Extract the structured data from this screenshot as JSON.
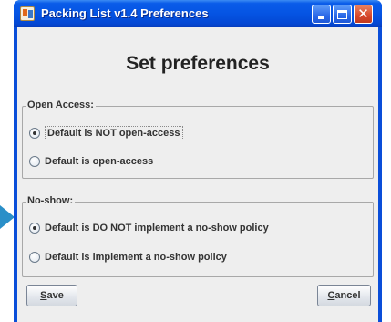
{
  "window": {
    "title": "Packing List v1.4 Preferences",
    "controls": [
      "minimize",
      "maximize",
      "close"
    ]
  },
  "dialog": {
    "heading": "Set preferences",
    "groups": [
      {
        "label": "Open Access:",
        "options": [
          {
            "label": "Default is NOT open-access",
            "checked": true
          },
          {
            "label": "Default is open-access",
            "checked": false
          }
        ]
      },
      {
        "label": "No-show:",
        "options": [
          {
            "label": "Default is DO NOT implement a no-show policy",
            "checked": true
          },
          {
            "label": "Default is implement a no-show policy",
            "checked": false
          }
        ]
      }
    ]
  },
  "buttons": {
    "save": {
      "mnemonic": "S",
      "rest": "ave"
    },
    "cancel": {
      "mnemonic": "C",
      "rest": "ancel"
    }
  },
  "colors": {
    "titlebar": "#0554e3",
    "client_bg": "#eeeeee",
    "arrow": "#2a8fc8"
  }
}
